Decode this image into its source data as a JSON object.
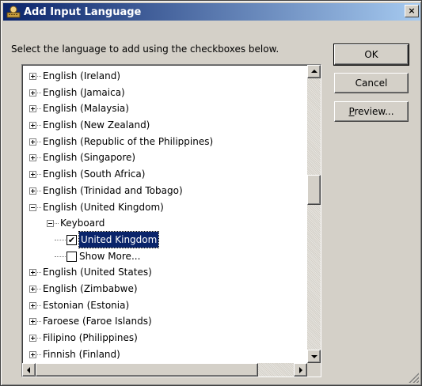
{
  "dialog": {
    "title": "Add Input Language",
    "close_glyph": "×",
    "icon": "input-language-icon",
    "instruction": "Select the language to add using the checkboxes below.",
    "buttons": {
      "ok": "OK",
      "cancel": "Cancel",
      "preview": "Preview..."
    },
    "colors": {
      "title_start": "#0a246a",
      "title_end": "#a6caf0",
      "face": "#d4d0c8",
      "selection": "#0a246a"
    }
  },
  "tree": {
    "items": [
      {
        "label": "English (Ireland)",
        "level": 0,
        "type": "node",
        "expanded": false
      },
      {
        "label": "English (Jamaica)",
        "level": 0,
        "type": "node",
        "expanded": false
      },
      {
        "label": "English (Malaysia)",
        "level": 0,
        "type": "node",
        "expanded": false
      },
      {
        "label": "English (New Zealand)",
        "level": 0,
        "type": "node",
        "expanded": false
      },
      {
        "label": "English (Republic of the Philippines)",
        "level": 0,
        "type": "node",
        "expanded": false
      },
      {
        "label": "English (Singapore)",
        "level": 0,
        "type": "node",
        "expanded": false
      },
      {
        "label": "English (South Africa)",
        "level": 0,
        "type": "node",
        "expanded": false
      },
      {
        "label": "English (Trinidad and Tobago)",
        "level": 0,
        "type": "node",
        "expanded": false
      },
      {
        "label": "English (United Kingdom)",
        "level": 0,
        "type": "node",
        "expanded": true
      },
      {
        "label": "Keyboard",
        "level": 1,
        "type": "node",
        "expanded": true
      },
      {
        "label": "United Kingdom",
        "level": 2,
        "type": "check",
        "checked": true,
        "selected": true
      },
      {
        "label": "Show More...",
        "level": 2,
        "type": "check",
        "checked": false
      },
      {
        "label": "English (United States)",
        "level": 0,
        "type": "node",
        "expanded": false
      },
      {
        "label": "English (Zimbabwe)",
        "level": 0,
        "type": "node",
        "expanded": false
      },
      {
        "label": "Estonian (Estonia)",
        "level": 0,
        "type": "node",
        "expanded": false
      },
      {
        "label": "Faroese (Faroe Islands)",
        "level": 0,
        "type": "node",
        "expanded": false
      },
      {
        "label": "Filipino (Philippines)",
        "level": 0,
        "type": "node",
        "expanded": false
      },
      {
        "label": "Finnish (Finland)",
        "level": 0,
        "type": "node",
        "expanded": false
      }
    ]
  },
  "scrollbars": {
    "vertical_position": 0.4
  }
}
